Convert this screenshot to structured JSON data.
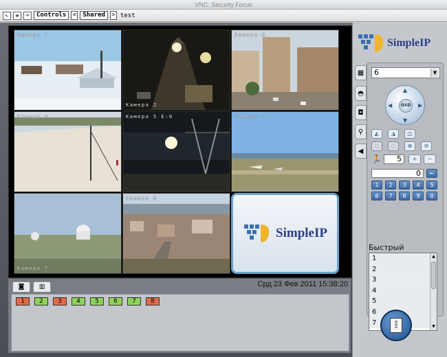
{
  "window": {
    "title": "VNC: Security Focus"
  },
  "toolbar": {
    "controls_label": "Controls",
    "shared_label": "Shared",
    "prev_arrow": "<",
    "next_arrow": ">",
    "text": "test"
  },
  "cameras": [
    {
      "label": "Камера 1"
    },
    {
      "label": "Камера 2"
    },
    {
      "label": "Камера 3"
    },
    {
      "label": "Камера 4"
    },
    {
      "label": "Камера 5 E:0"
    },
    {
      "label": "Камера 6"
    },
    {
      "label": "Камера 7"
    },
    {
      "label": "Камера 8"
    }
  ],
  "brand": {
    "logo_text": "SimpleIP"
  },
  "status": {
    "datetime": "Срд 23 Фев 2011 15:38:20"
  },
  "channels": [
    {
      "label": "1",
      "state": "red"
    },
    {
      "label": "2",
      "state": "green"
    },
    {
      "label": "3",
      "state": "red"
    },
    {
      "label": "4",
      "state": "green"
    },
    {
      "label": "5",
      "state": "green"
    },
    {
      "label": "6",
      "state": "green"
    },
    {
      "label": "7",
      "state": "green"
    },
    {
      "label": "8",
      "state": "red"
    }
  ],
  "controls": {
    "layout_select_value": "6",
    "ptz_center_label": "OSD",
    "zoom_field_value": "0",
    "speed_value": "5",
    "plus_label": "+",
    "minus_label": "−",
    "numpad": [
      "1",
      "2",
      "3",
      "4",
      "5",
      "6",
      "7",
      "8",
      "9",
      "0"
    ],
    "preset_title": "Быстрый",
    "presets": [
      "1",
      "2",
      "3",
      "4",
      "5",
      "6",
      "7"
    ]
  },
  "colors": {
    "accent_blue": "#3e6aa7",
    "channel_green": "#8fd35a",
    "channel_red": "#e06a4a",
    "logo_navy": "#2d3d86"
  }
}
